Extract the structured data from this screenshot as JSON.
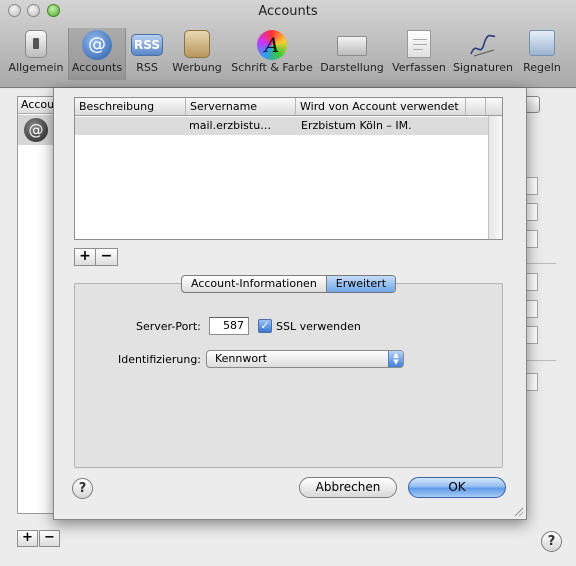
{
  "window": {
    "title": "Accounts"
  },
  "toolbar": {
    "items": [
      {
        "label": "Allgemein",
        "icon": "switch-icon"
      },
      {
        "label": "Accounts",
        "icon": "at-icon",
        "selected": true
      },
      {
        "label": "RSS",
        "icon": "rss-icon",
        "badge": "RSS"
      },
      {
        "label": "Werbung",
        "icon": "junk-mail-icon"
      },
      {
        "label": "Schrift & Farbe",
        "icon": "font-color-icon",
        "glyph": "A"
      },
      {
        "label": "Darstellung",
        "icon": "viewing-icon"
      },
      {
        "label": "Verfassen",
        "icon": "compose-icon"
      },
      {
        "label": "Signaturen",
        "icon": "signature-icon"
      },
      {
        "label": "Regeln",
        "icon": "rules-icon"
      }
    ]
  },
  "background": {
    "account_list_header": "Accou",
    "account_icon_glyph": "@",
    "add": "+",
    "remove": "−",
    "help": "?"
  },
  "sheet": {
    "table": {
      "columns": [
        "Beschreibung",
        "Servername",
        "Wird von Account verwendet"
      ],
      "rows": [
        {
          "description": "",
          "server": "mail.erzbistu…",
          "used_by": "Erzbistum Köln – IM."
        }
      ]
    },
    "table_buttons": {
      "add": "+",
      "remove": "−"
    },
    "tabs": {
      "items": [
        "Account-Informationen",
        "Erweitert"
      ],
      "active": "Erweitert"
    },
    "server_port": {
      "label": "Server-Port:",
      "value": "587"
    },
    "ssl": {
      "label": "SSL verwenden",
      "checked": true,
      "check_glyph": "✓"
    },
    "auth": {
      "label": "Identifizierung:",
      "value": "Kennwort",
      "arrows": "▲▼"
    },
    "help": "?",
    "cancel_label": "Abbrechen",
    "ok_label": "OK"
  }
}
